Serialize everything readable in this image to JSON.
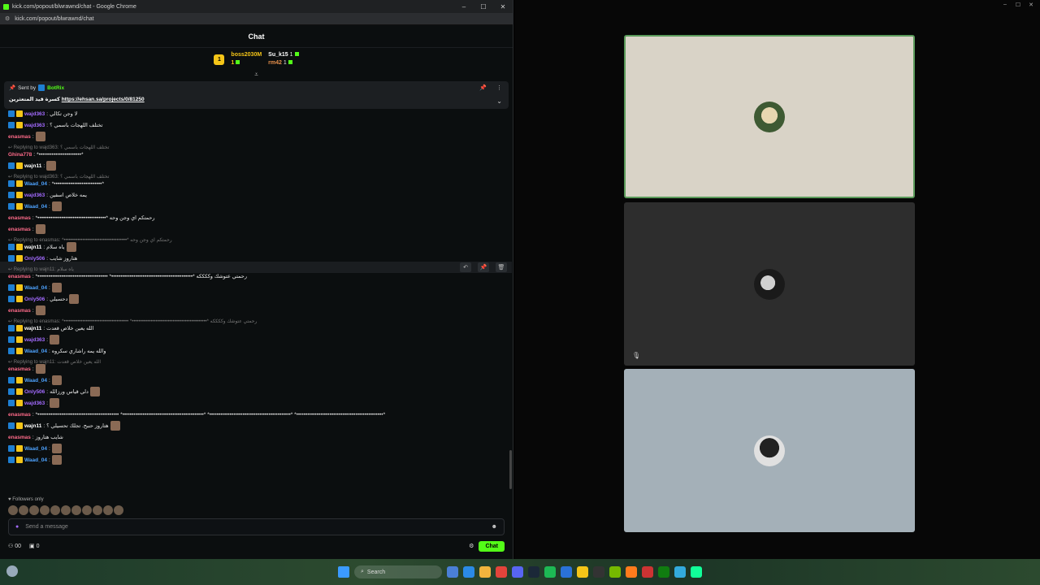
{
  "left_window": {
    "title": "kick.com/popout/blwrawnd/chat - Google Chrome",
    "url": "kick.com/popout/blwrawnd/chat",
    "controls": [
      "–",
      "☐",
      "✕"
    ]
  },
  "chat": {
    "header": "Chat",
    "leaders": [
      {
        "name": "boss2030M",
        "count": "1",
        "rank": "1"
      },
      {
        "name": "Su_k15",
        "count": "1"
      },
      {
        "name": "rm42",
        "count": "1"
      }
    ],
    "pinned": {
      "sent_by_label": "Sent by",
      "sender": "BotRix",
      "text": "كسرة قيد المتعثرين",
      "link": "https://ehsan.sa/projects/0/81250"
    },
    "messages": [
      {
        "user": "wajd363",
        "text": "لا وجن تكالي",
        "color": "purple"
      },
      {
        "user": "wajd363",
        "text": "تختلف اللهجات باسمي ؟",
        "color": "purple"
      },
      {
        "user": "enasmas",
        "text": "",
        "color": "pink",
        "emote": true
      },
      {
        "reply": "Replying to wajd363: تختلف اللهجات باسمي ؟"
      },
      {
        "user": "Ghina778",
        "text": "*•••••••••••••••••••••••*",
        "color": "pink"
      },
      {
        "user": "wajn11",
        "text": "",
        "color": "white",
        "emote": true
      },
      {
        "reply": "Replying to wajd363: تختلف اللهجات باسمي ؟"
      },
      {
        "user": "Waad_04",
        "text": "*••••••••••••••••••••••••••*",
        "color": "blue"
      },
      {
        "user": "wajd363",
        "text": "يمه خلاص اسفين",
        "color": "purple"
      },
      {
        "user": "Waad_04",
        "text": "",
        "color": "blue",
        "emote": true
      },
      {
        "user": "enasmas",
        "text": "*•••••••••••••••••••••••••••••••••••••* رحمتكم اي وجن وحه",
        "color": "pink"
      },
      {
        "user": "enasmas",
        "text": "",
        "color": "pink",
        "emote": true
      },
      {
        "reply": "Replying to enasmas: *•••••••••••••••••••••••••••••••••••••* رحمتكم اي وجن وحه"
      },
      {
        "user": "wajn11",
        "text": "ياه سلام",
        "color": "white",
        "emote": true
      },
      {
        "user": "Only506",
        "text": "هتاروز شايب",
        "color": "purple"
      },
      {
        "reply": "Replying to wajn11: ياه سلام"
      },
      {
        "user": "enasmas",
        "text": "*•••••••••••••••••••••••••••••••••••••• *••••••••••••••••••••••••••••••••••••••••••••* رحمتي عتوشك وككككه",
        "color": "pink"
      },
      {
        "user": "Waad_04",
        "text": "",
        "color": "blue",
        "emote": true
      },
      {
        "user": "Only506",
        "text": "دحسيلي",
        "color": "purple",
        "emote": true
      },
      {
        "user": "enasmas",
        "text": "",
        "color": "pink",
        "emote": true
      },
      {
        "reply": "Replying to enasmas: *•••••••••••••••••••••••••••••••••••••• *••••••••••••••••••••••••••••••••••••••••••••* رحمتي عتوشك وككككه"
      },
      {
        "user": "wajn11",
        "text": "الله يعين خلاص قعدت",
        "color": "white"
      },
      {
        "user": "wajd363",
        "text": "",
        "color": "purple",
        "emote": true
      },
      {
        "user": "Waad_04",
        "text": "والله يمه راشاري سكروه",
        "color": "blue"
      },
      {
        "reply": "Replying to wajn11: الله يعين خلاص قعدت"
      },
      {
        "user": "enasmas",
        "text": "",
        "color": "pink",
        "emote": true
      },
      {
        "user": "Waad_04",
        "text": "",
        "color": "blue",
        "emote": true
      },
      {
        "user": "Only506",
        "text": "دلي قياس ورزالله",
        "color": "purple",
        "emote": true
      },
      {
        "user": "wajd363",
        "text": "",
        "color": "purple",
        "emote": true
      },
      {
        "user": "enasmas",
        "text": "*•••••••••••••••••••••••••••••••••••••••••••• *••••••••••••••••••••••••••••••••••••••••••••* *••••••••••••••••••••••••••••••••••••••••••••* *•••••••••••••••••••••••••••••••••••••••••••••••*",
        "color": "pink"
      },
      {
        "user": "wajn11",
        "text": "هتاروز حنبح. تجلك تحسيلي ؟",
        "color": "white",
        "emote": true
      },
      {
        "user": "enasmas",
        "text": "شايب هتاروز",
        "color": "pink"
      },
      {
        "user": "Waad_04",
        "text": "",
        "color": "blue",
        "emote": true
      },
      {
        "user": "Waad_04",
        "text": "",
        "color": "blue",
        "emote": true
      }
    ],
    "followers_only": "Followers only",
    "input_placeholder": "Send a message",
    "bottom": {
      "viewers": "00",
      "count": "0",
      "chat_button": "Chat"
    }
  },
  "taskbar": {
    "search_placeholder": "Search"
  }
}
